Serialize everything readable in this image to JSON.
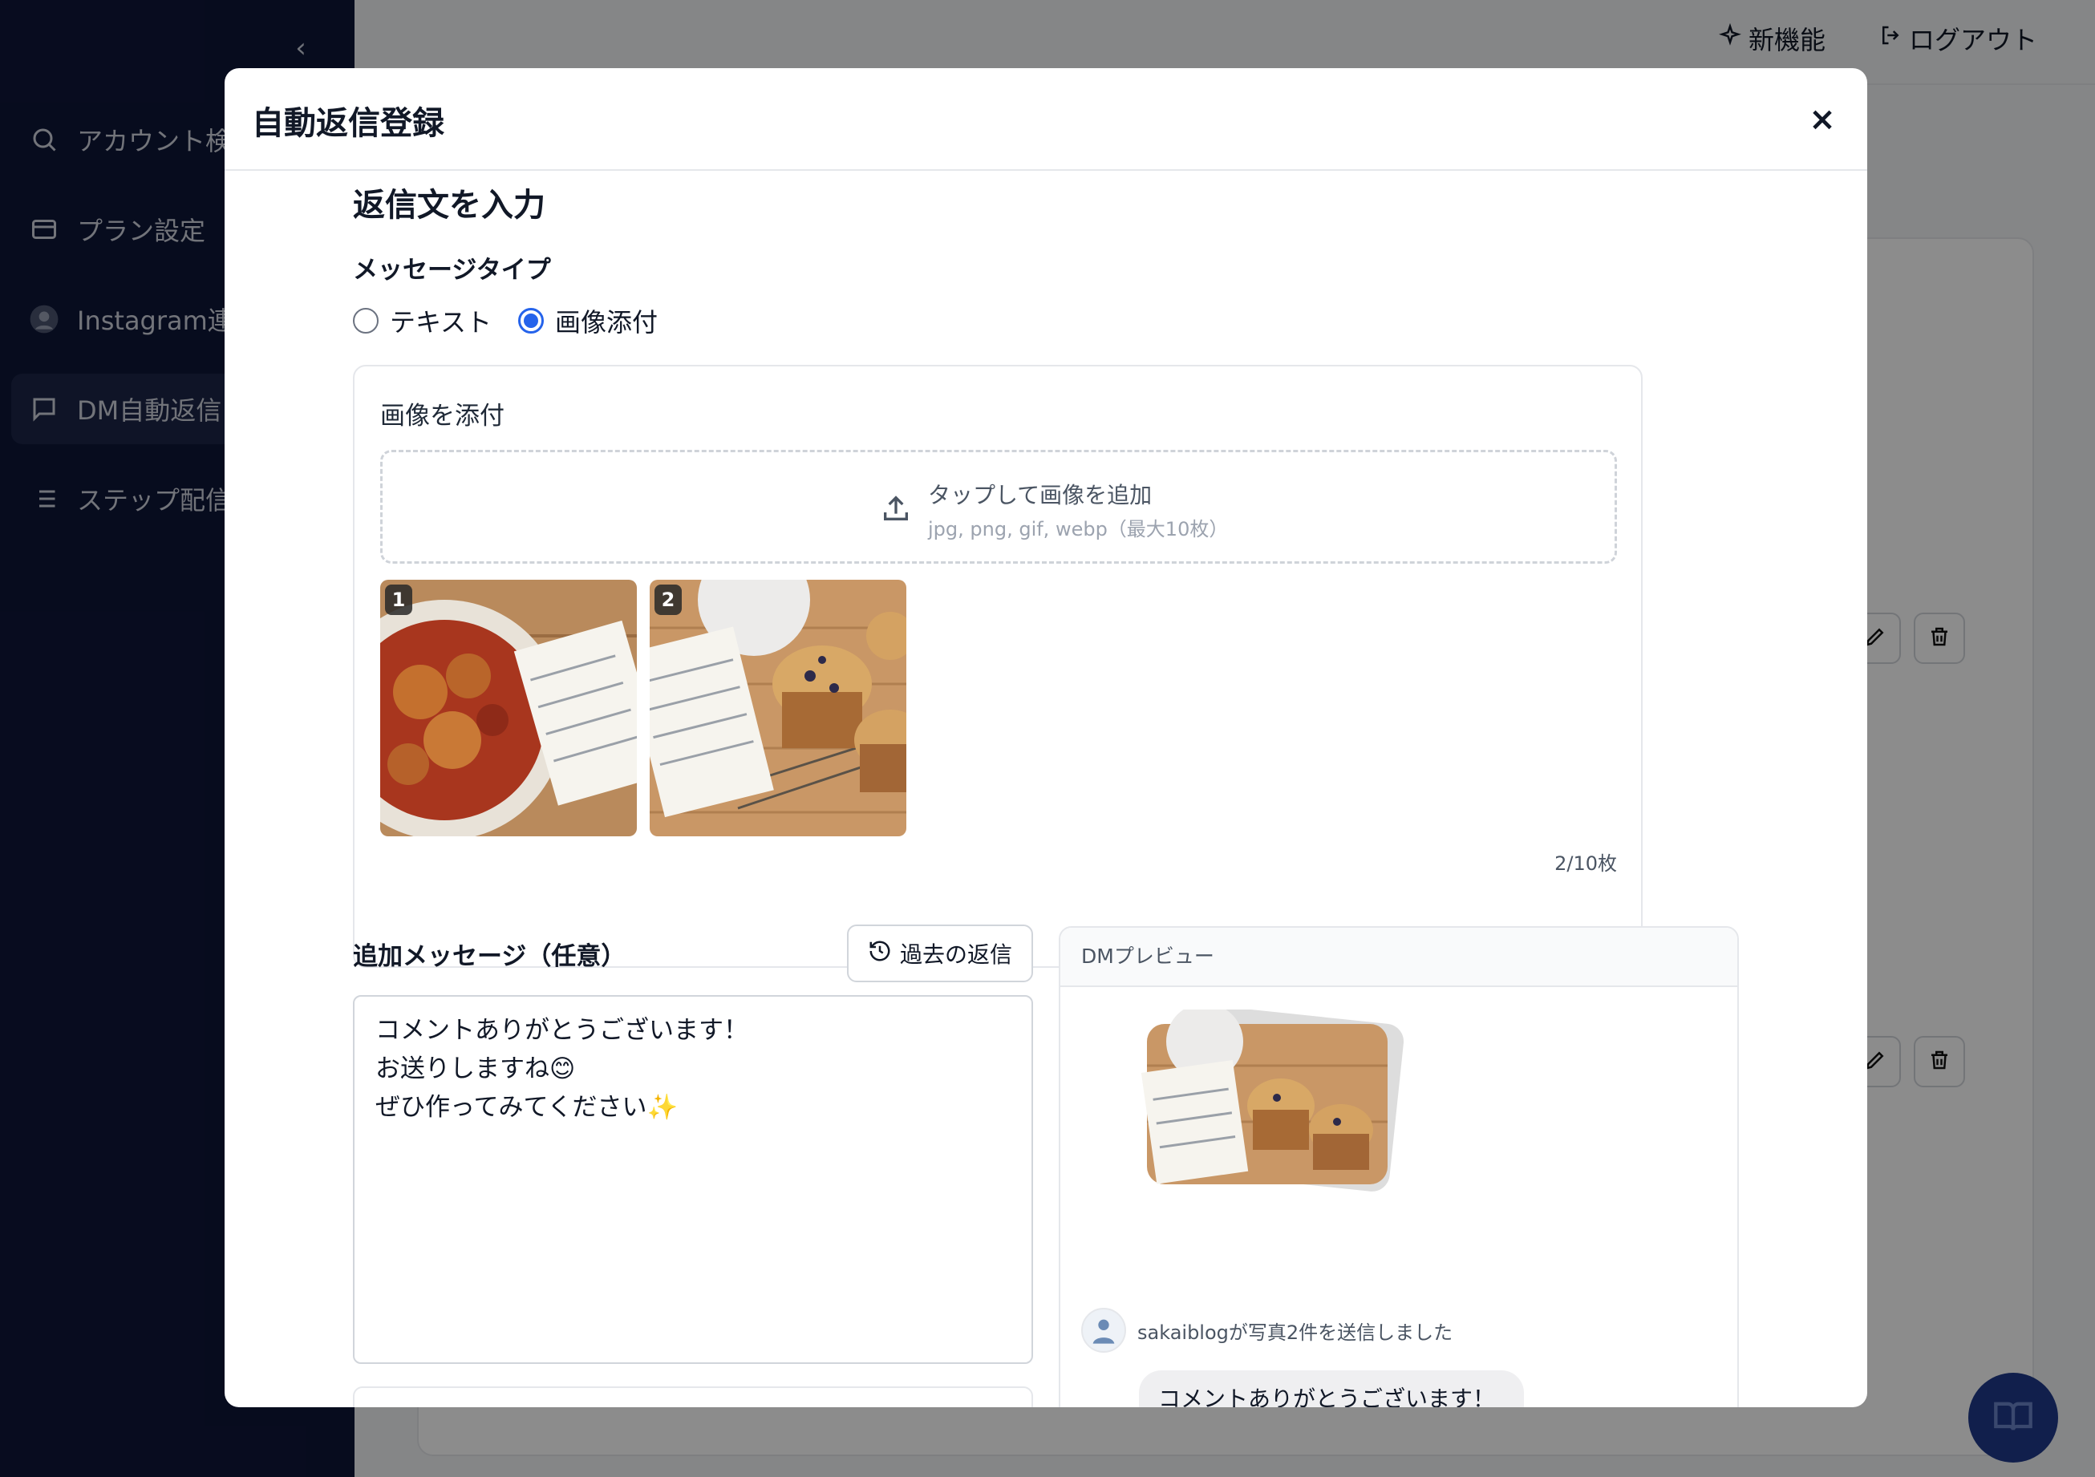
{
  "sidebar": {
    "items": [
      {
        "label": "アカウント検索",
        "icon": "search-icon"
      },
      {
        "label": "プラン設定",
        "icon": "card-icon"
      },
      {
        "label": "Instagram連携",
        "icon": "instagram-avatar-icon"
      },
      {
        "label": "DM自動返信",
        "icon": "chat-icon"
      },
      {
        "label": "ステップ配信",
        "icon": "list-icon"
      }
    ]
  },
  "topbar": {
    "new_features": "新機能",
    "logout": "ログアウト"
  },
  "modal": {
    "title": "自動返信登録",
    "close": "×",
    "section_title": "返信文を入力",
    "message_type_label": "メッセージタイプ",
    "options": [
      {
        "label": "テキスト",
        "checked": false
      },
      {
        "label": "画像添付",
        "checked": true
      }
    ],
    "attach": {
      "title": "画像を添付",
      "dropzone_main": "タップして画像を追加",
      "dropzone_sub": "jpg, png, gif, webp（最大10枚）",
      "images": [
        {
          "index": "1",
          "subject": "recipe-chicken-tomato-stew"
        },
        {
          "index": "2",
          "subject": "recipe-blueberry-muffin"
        }
      ],
      "counter": "2/10枚"
    },
    "additional_message_label": "追加メッセージ（任意）",
    "history_button": "過去の返信",
    "message_text": "コメントありがとうございます！\nお送りしますね😊\nぜひ作ってみてください✨",
    "preview": {
      "header": "DMプレビュー",
      "sent_notice": "sakaiblogが写真2件を送信しました",
      "bubble_text": "コメントありがとうございます！\nお送りしますね😊\nぜひ作ってみてください✨"
    }
  },
  "colors": {
    "sidebar_bg": "#0e1638",
    "accent": "#2563eb",
    "fab": "#1f3a8a"
  }
}
